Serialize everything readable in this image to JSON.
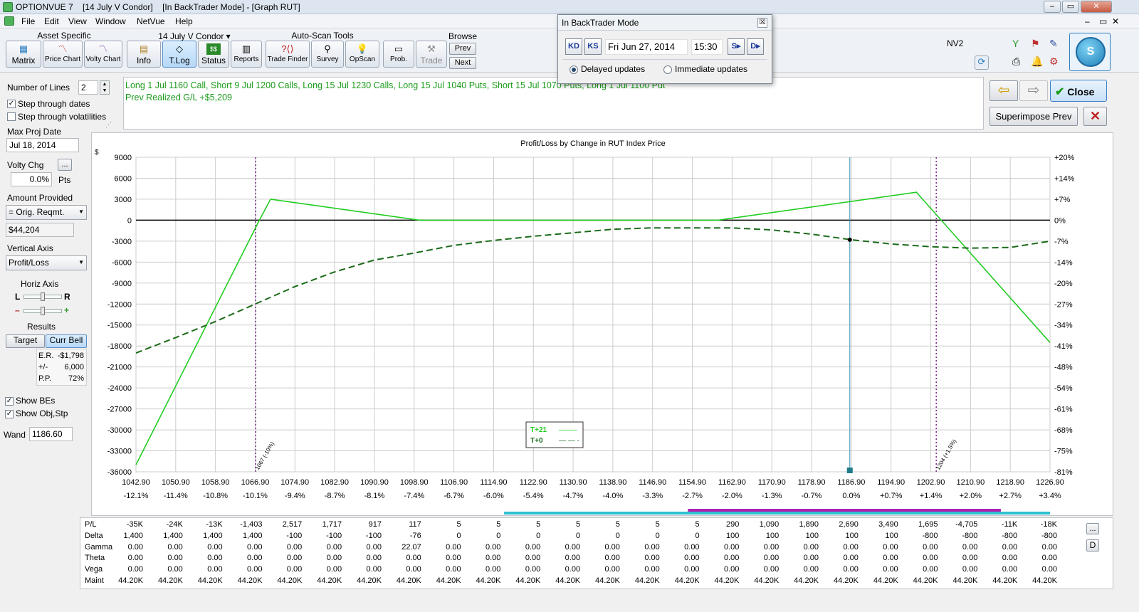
{
  "window": {
    "title": "OPTIONVUE 7    [14 July V Condor]    [In BackTrader Mode] - [Graph RUT]",
    "inner_controls": [
      "–",
      "▭",
      "✕"
    ]
  },
  "menu": [
    "File",
    "Edit",
    "View",
    "Window",
    "NetVue",
    "Help"
  ],
  "toolbar": {
    "asset_specific_label": "Asset Specific",
    "asset_buttons": [
      "Matrix",
      "Price Chart",
      "Volty Chart"
    ],
    "position_label": "14 July V Condor ▾",
    "position_buttons": [
      "Info",
      "T.Log",
      "Status",
      "Reports"
    ],
    "autoscan_label": "Auto-Scan Tools",
    "autoscan_buttons": [
      "Trade Finder",
      "Survey",
      "OpScan"
    ],
    "prob_label": "Prob.",
    "trade_label": "Trade",
    "browse_label": "Browse",
    "browse_prev": "Prev",
    "browse_next": "Next",
    "nv2_label": "NV2",
    "accent": "#2b7fc1"
  },
  "backtrader_dialog": {
    "title": "In BackTrader Mode",
    "close": "☒",
    "date": "Fri Jun 27, 2014",
    "time": "15:30",
    "btn_back_day": "KD",
    "btn_back_session": "KS",
    "btn_fwd_session": "S▸",
    "btn_fwd_day": "D▸",
    "radio_delayed": "Delayed updates",
    "radio_immediate": "Immediate updates",
    "selected": "delayed"
  },
  "left_panel": {
    "num_lines_label": "Number of Lines",
    "num_lines_value": "2",
    "step_dates_label": "Step through dates",
    "step_dates_checked": true,
    "step_vols_label": "Step through volatilities",
    "step_vols_checked": false,
    "max_proj_date_label": "Max Proj Date",
    "max_proj_date_value": "Jul 18, 2014",
    "volty_chg_label": "Volty Chg",
    "volty_chg_button": "...",
    "volty_chg_value": "0.0%",
    "volty_chg_unit": "Pts",
    "amount_provided_label": "Amount Provided",
    "amount_provided_value": "= Orig. Reqmt.",
    "amount_value": "$44,204",
    "vertical_axis_label": "Vertical Axis",
    "vertical_axis_value": "Profit/Loss",
    "horiz_axis_label": "Horiz Axis",
    "horiz_L": "L",
    "horiz_R": "R",
    "zoom_minus": "–",
    "zoom_plus": "+",
    "results_label": "Results",
    "target_btn": "Target",
    "curr_bell_btn": "Curr Bell",
    "er_label": "E.R.",
    "er_value": "-$1,798",
    "pm_label": "+/-",
    "pm_value": "6,000",
    "pp_label": "P.P.",
    "pp_value": "72%",
    "show_bes_label": "Show BEs",
    "show_bes_checked": true,
    "show_obj_label": "Show Obj,Stp",
    "show_obj_checked": true,
    "wand_label": "Wand",
    "wand_value": "1186.60"
  },
  "description": {
    "line1": "Long 1 Jul 1160 Call, Short 9 Jul 1200 Calls, Long 15 Jul 1230 Calls, Long 15 Jul 1040 Puts, Short 15 Jul 1070 Puts, Long 1 Jul 1100 Put",
    "line2": "Prev Realized G/L +$5,209"
  },
  "right_buttons": {
    "back_arrow": "⇦",
    "fwd_arrow": "⇨",
    "close": "Close",
    "superimpose": "Superimpose Prev",
    "delete_icon": "✕"
  },
  "chart_data": {
    "type": "line",
    "title": "Profit/Loss by Change in RUT Index Price",
    "ylabel": "$",
    "ylim": [
      -36000,
      9000
    ],
    "xlim": [
      1042.9,
      1226.9
    ],
    "y_ticks": [
      9000,
      6000,
      3000,
      0,
      -3000,
      -6000,
      -9000,
      -12000,
      -15000,
      -18000,
      -21000,
      -24000,
      -27000,
      -30000,
      -33000,
      -36000
    ],
    "y2_ticks": [
      "+20%",
      "+14%",
      "+7%",
      "0%",
      "-7%",
      "-14%",
      "-20%",
      "-27%",
      "-34%",
      "-41%",
      "-48%",
      "-54%",
      "-61%",
      "-68%",
      "-75%",
      "-81%"
    ],
    "x_ticks": [
      1042.9,
      1050.9,
      1058.9,
      1066.9,
      1074.9,
      1082.9,
      1090.9,
      1098.9,
      1106.9,
      1114.9,
      1122.9,
      1130.9,
      1138.9,
      1146.9,
      1154.9,
      1162.9,
      1170.9,
      1178.9,
      1186.9,
      1194.9,
      1202.9,
      1210.9,
      1218.9,
      1226.9
    ],
    "x_tick_labels": [
      "1042.90",
      "1050.90",
      "1058.90",
      "1066.90",
      "1074.90",
      "1082.90",
      "1090.90",
      "1098.90",
      "1106.90",
      "1114.90",
      "1122.90",
      "1130.90",
      "1138.90",
      "1146.90",
      "1154.90",
      "1162.90",
      "1170.90",
      "1178.90",
      "1186.90",
      "1194.90",
      "1202.90",
      "1210.90",
      "1218.90",
      "1226.90"
    ],
    "x_pct_labels": [
      "-12.1%",
      "-11.4%",
      "-10.8%",
      "-10.1%",
      "-9.4%",
      "-8.7%",
      "-8.1%",
      "-7.4%",
      "-6.7%",
      "-6.0%",
      "-5.4%",
      "-4.7%",
      "-4.0%",
      "-3.3%",
      "-2.7%",
      "-2.0%",
      "-1.3%",
      "-0.7%",
      "0.0%",
      "+0.7%",
      "+1.4%",
      "+2.0%",
      "+2.7%",
      "+3.4%"
    ],
    "series": [
      {
        "name": "T+21",
        "color": "#22cc22",
        "dash": false,
        "x": [
          1042.9,
          1067.6,
          1070.0,
          1100.0,
          1160.0,
          1200.0,
          1205.0,
          1226.9
        ],
        "y": [
          -35000,
          -200,
          3000,
          0,
          0,
          4000,
          0,
          -17500
        ]
      },
      {
        "name": "T+0",
        "color": "#1b6b1b",
        "dash": true,
        "x": [
          1042.9,
          1050.9,
          1058.9,
          1066.9,
          1074.9,
          1082.9,
          1090.9,
          1098.9,
          1106.9,
          1114.9,
          1122.9,
          1130.9,
          1138.9,
          1146.9,
          1154.9,
          1162.9,
          1170.9,
          1178.9,
          1186.9,
          1194.9,
          1202.9,
          1210.9,
          1218.9,
          1226.9
        ],
        "y": [
          -19000,
          -16800,
          -14500,
          -12000,
          -9500,
          -7400,
          -5700,
          -4700,
          -3600,
          -2900,
          -2300,
          -1800,
          -1300,
          -1100,
          -1100,
          -1100,
          -1400,
          -2000,
          -2800,
          -3400,
          -3800,
          -4000,
          -3900,
          -3000
        ]
      }
    ],
    "markers": [
      {
        "x": 1067.0,
        "label": "1067 (-10%)"
      },
      {
        "x": 1204.0,
        "label": "1204 (+1.5%)"
      }
    ],
    "wand_x": 1186.6,
    "wand_point_y": -2800,
    "legend": [
      {
        "label": "T+21",
        "sample": "–——"
      },
      {
        "label": "T+0",
        "sample": "— — -"
      }
    ],
    "legend_position": "bottom-center",
    "bands": [
      {
        "from": 1117.0,
        "to": 1226.9,
        "color": "#30c0d0"
      },
      {
        "from": 1154.0,
        "to": 1217.0,
        "color": "#b020b0"
      }
    ]
  },
  "table": {
    "rows": [
      {
        "label": "P/L",
        "values": [
          "-35K",
          "-24K",
          "-13K",
          "-1,403",
          "2,517",
          "1,717",
          "917",
          "117",
          "5",
          "5",
          "5",
          "5",
          "5",
          "5",
          "5",
          "290",
          "1,090",
          "1,890",
          "2,690",
          "3,490",
          "1,695",
          "-4,705",
          "-11K",
          "-18K"
        ]
      },
      {
        "label": "Delta",
        "values": [
          "1,400",
          "1,400",
          "1,400",
          "1,400",
          "-100",
          "-100",
          "-100",
          "-76",
          "0",
          "0",
          "0",
          "0",
          "0",
          "0",
          "0",
          "100",
          "100",
          "100",
          "100",
          "100",
          "-800",
          "-800",
          "-800",
          "-800"
        ]
      },
      {
        "label": "Gamma",
        "values": [
          "0.00",
          "0.00",
          "0.00",
          "0.00",
          "0.00",
          "0.00",
          "0.00",
          "22.07",
          "0.00",
          "0.00",
          "0.00",
          "0.00",
          "0.00",
          "0.00",
          "0.00",
          "0.00",
          "0.00",
          "0.00",
          "0.00",
          "0.00",
          "0.00",
          "0.00",
          "0.00",
          "0.00"
        ]
      },
      {
        "label": "Theta",
        "values": [
          "0.00",
          "0.00",
          "0.00",
          "0.00",
          "0.00",
          "0.00",
          "0.00",
          "0.00",
          "0.00",
          "0.00",
          "0.00",
          "0.00",
          "0.00",
          "0.00",
          "0.00",
          "0.00",
          "0.00",
          "0.00",
          "0.00",
          "0.00",
          "0.00",
          "0.00",
          "0.00",
          "0.00"
        ]
      },
      {
        "label": "Vega",
        "values": [
          "0.00",
          "0.00",
          "0.00",
          "0.00",
          "0.00",
          "0.00",
          "0.00",
          "0.00",
          "0.00",
          "0.00",
          "0.00",
          "0.00",
          "0.00",
          "0.00",
          "0.00",
          "0.00",
          "0.00",
          "0.00",
          "0.00",
          "0.00",
          "0.00",
          "0.00",
          "0.00",
          "0.00"
        ]
      },
      {
        "label": "Maint",
        "values": [
          "44.20K",
          "44.20K",
          "44.20K",
          "44.20K",
          "44.20K",
          "44.20K",
          "44.20K",
          "44.20K",
          "44.20K",
          "44.20K",
          "44.20K",
          "44.20K",
          "44.20K",
          "44.20K",
          "44.20K",
          "44.20K",
          "44.20K",
          "44.20K",
          "44.20K",
          "44.20K",
          "44.20K",
          "44.20K",
          "44.20K",
          "44.20K"
        ]
      }
    ],
    "side_btn1": "...",
    "side_btn2": "D"
  }
}
